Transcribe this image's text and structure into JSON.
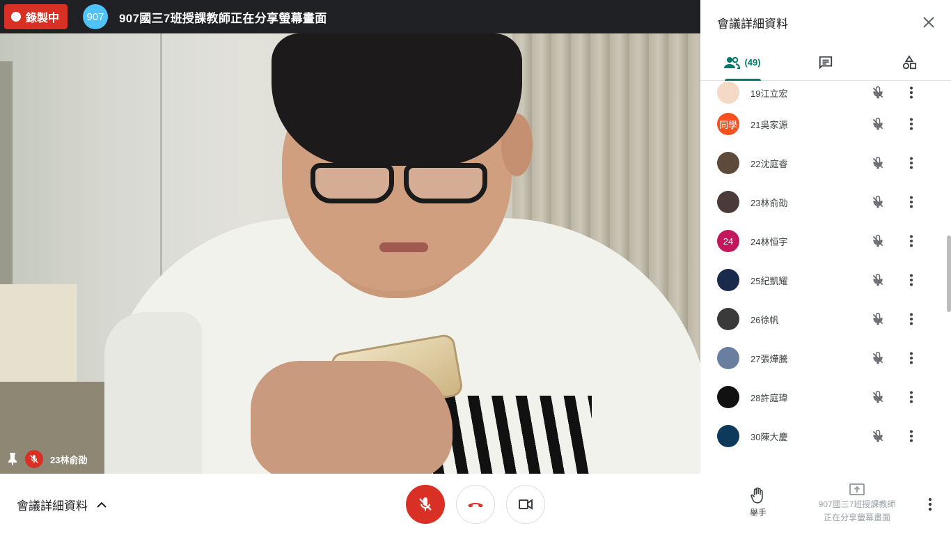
{
  "topbar": {
    "recording_label": "錄製中",
    "meeting_avatar": "907",
    "meeting_title": "907國三7班授課教師正在分享螢幕畫面"
  },
  "video": {
    "participant_name": "23林俞劭"
  },
  "panel": {
    "title": "會議詳細資料",
    "people_count": "(49)",
    "participants": [
      {
        "name": "19江立宏",
        "avatar_text": "",
        "avatar_color": "#f3d9c6"
      },
      {
        "name": "21吳家源",
        "avatar_text": "同學",
        "avatar_color": "#f4511e"
      },
      {
        "name": "22沈庭睿",
        "avatar_text": "",
        "avatar_color": "#5d4a3a"
      },
      {
        "name": "23林俞劭",
        "avatar_text": "",
        "avatar_color": "#4a3a3a"
      },
      {
        "name": "24林恒宇",
        "avatar_text": "24",
        "avatar_color": "#c2185b"
      },
      {
        "name": "25紀凱耀",
        "avatar_text": "",
        "avatar_color": "#1a2a4a"
      },
      {
        "name": "26徐帆",
        "avatar_text": "",
        "avatar_color": "#3a3a3a"
      },
      {
        "name": "27張燁騰",
        "avatar_text": "",
        "avatar_color": "#6a7fa0"
      },
      {
        "name": "28許庭瑋",
        "avatar_text": "",
        "avatar_color": "#111111"
      },
      {
        "name": "30陳大慶",
        "avatar_text": "",
        "avatar_color": "#0d3a5a"
      }
    ]
  },
  "bottom": {
    "details_label": "會議詳細資料",
    "raise_hand_label": "舉手",
    "presenting_line1": "907國三7班授課教師",
    "presenting_line2": "正在分享螢幕畫面"
  },
  "colors": {
    "accent": "#00796b",
    "danger": "#d93025",
    "topbar_bg": "#202124"
  }
}
